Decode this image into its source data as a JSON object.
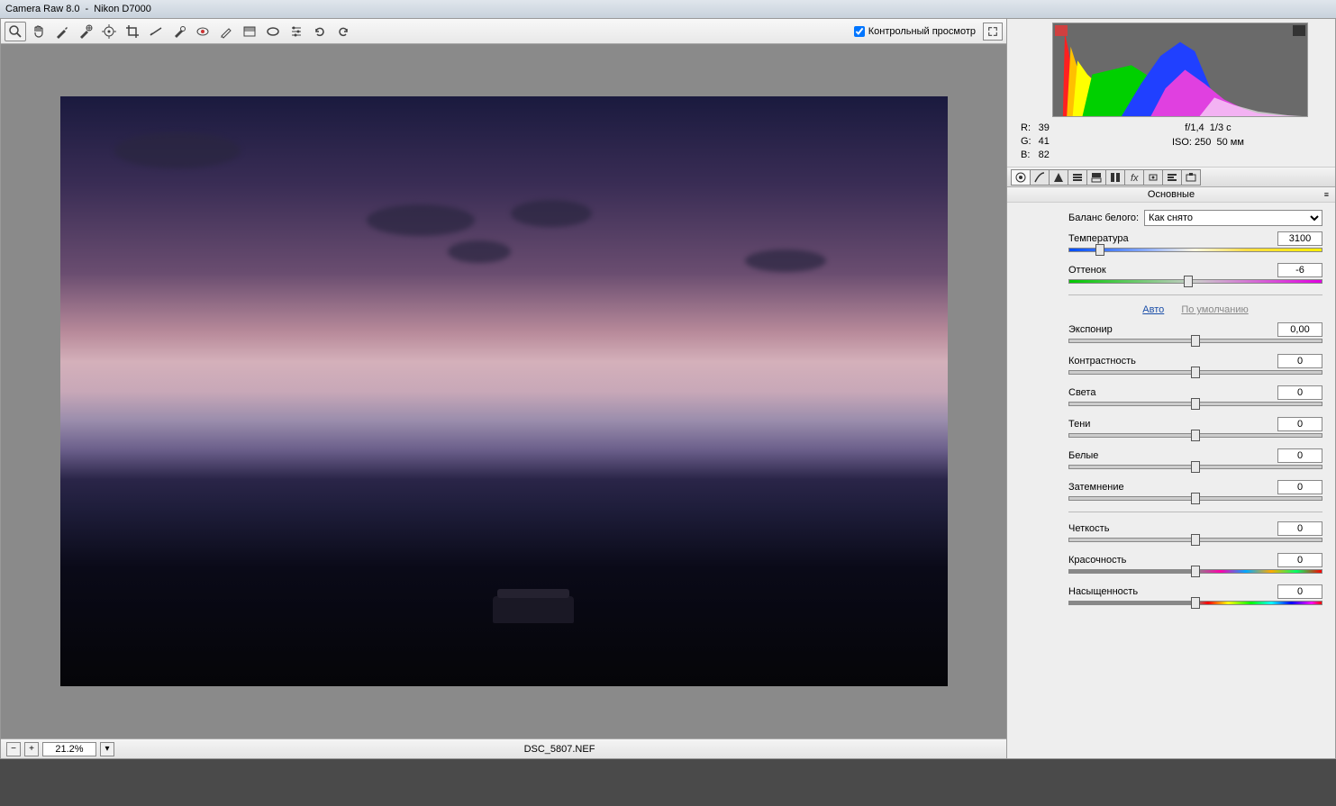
{
  "title": {
    "app": "Camera Raw 8.0",
    "sep": "-",
    "camera": "Nikon D7000"
  },
  "toolbar": {
    "preview_label": "Контрольный просмотр"
  },
  "info": {
    "r_label": "R:",
    "r": "39",
    "g_label": "G:",
    "g": "41",
    "b_label": "B:",
    "b": "82",
    "aperture": "f/1,4",
    "shutter": "1/3 с",
    "iso_label": "ISO:",
    "iso": "250",
    "focal": "50 мм"
  },
  "panel_title": "Основные",
  "wb": {
    "label": "Баланс белого:",
    "value": "Как снято"
  },
  "sliders": {
    "temperature": {
      "label": "Температура",
      "value": "3100",
      "pos": 12
    },
    "tint": {
      "label": "Оттенок",
      "value": "-6",
      "pos": 47
    },
    "exposure": {
      "label": "Экспонир",
      "value": "0,00",
      "pos": 50
    },
    "contrast": {
      "label": "Контрастность",
      "value": "0",
      "pos": 50
    },
    "highlights": {
      "label": "Света",
      "value": "0",
      "pos": 50
    },
    "shadows": {
      "label": "Тени",
      "value": "0",
      "pos": 50
    },
    "whites": {
      "label": "Белые",
      "value": "0",
      "pos": 50
    },
    "blacks": {
      "label": "Затемнение",
      "value": "0",
      "pos": 50
    },
    "clarity": {
      "label": "Четкость",
      "value": "0",
      "pos": 50
    },
    "vibrance": {
      "label": "Красочность",
      "value": "0",
      "pos": 50
    },
    "saturation": {
      "label": "Насыщенность",
      "value": "0",
      "pos": 50
    }
  },
  "links": {
    "auto": "Авто",
    "default": "По умолчанию"
  },
  "status": {
    "zoom": "21.2%",
    "filename": "DSC_5807.NEF"
  }
}
